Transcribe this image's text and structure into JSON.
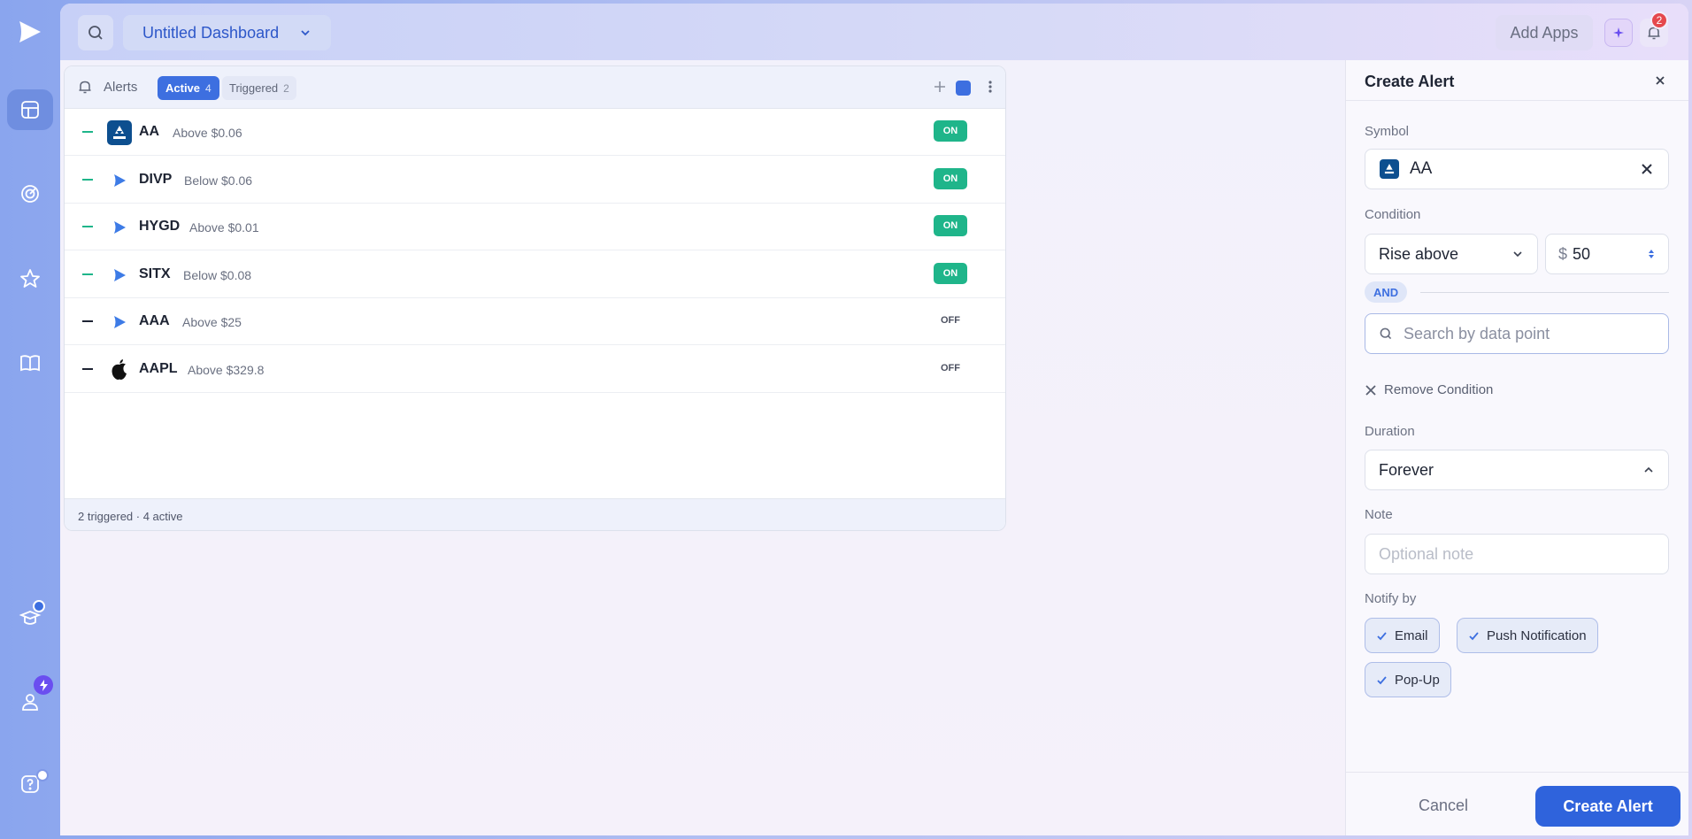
{
  "topbar": {
    "dashboard_name": "Untitled Dashboard",
    "add_apps_label": "Add Apps",
    "notification_count": "2"
  },
  "alerts_panel": {
    "title": "Alerts",
    "tabs": [
      {
        "label": "Active",
        "count": "4",
        "selected": true
      },
      {
        "label": "Triggered",
        "count": "2",
        "selected": false
      }
    ],
    "rows": [
      {
        "symbol": "AA",
        "condition": "Above $0.06",
        "status": "ON",
        "logo": "alcoa-logo"
      },
      {
        "symbol": "DIVP",
        "condition": "Below $0.06",
        "status": "ON",
        "logo": "play-logo"
      },
      {
        "symbol": "HYGD",
        "condition": "Above $0.01",
        "status": "ON",
        "logo": "play-logo"
      },
      {
        "symbol": "SITX",
        "condition": "Below $0.08",
        "status": "ON",
        "logo": "play-logo"
      },
      {
        "symbol": "AAA",
        "condition": "Above $25",
        "status": "OFF",
        "logo": "play-logo"
      },
      {
        "symbol": "AAPL",
        "condition": "Above $329.8",
        "status": "OFF",
        "logo": "apple-logo"
      }
    ],
    "footer": "2 triggered · 4 active"
  },
  "create_alert": {
    "title": "Create Alert",
    "symbol_label": "Symbol",
    "symbol_value": "AA",
    "condition_label": "Condition",
    "condition_value": "Rise above",
    "currency_symbol": "$",
    "threshold_value": "50",
    "and_label": "AND",
    "data_point_placeholder": "Search by data point",
    "remove_condition_label": "Remove Condition",
    "duration_label": "Duration",
    "duration_value": "Forever",
    "note_label": "Note",
    "note_placeholder": "Optional note",
    "notify_label": "Notify by",
    "notify_options": [
      {
        "label": "Email",
        "checked": true
      },
      {
        "label": "Push Notification",
        "checked": true
      },
      {
        "label": "Pop-Up",
        "checked": true
      }
    ],
    "cancel_label": "Cancel",
    "submit_label": "Create Alert"
  },
  "colors": {
    "accent": "#2f63dc",
    "on_green": "#1fb58a",
    "badge_red": "#e5484d"
  }
}
